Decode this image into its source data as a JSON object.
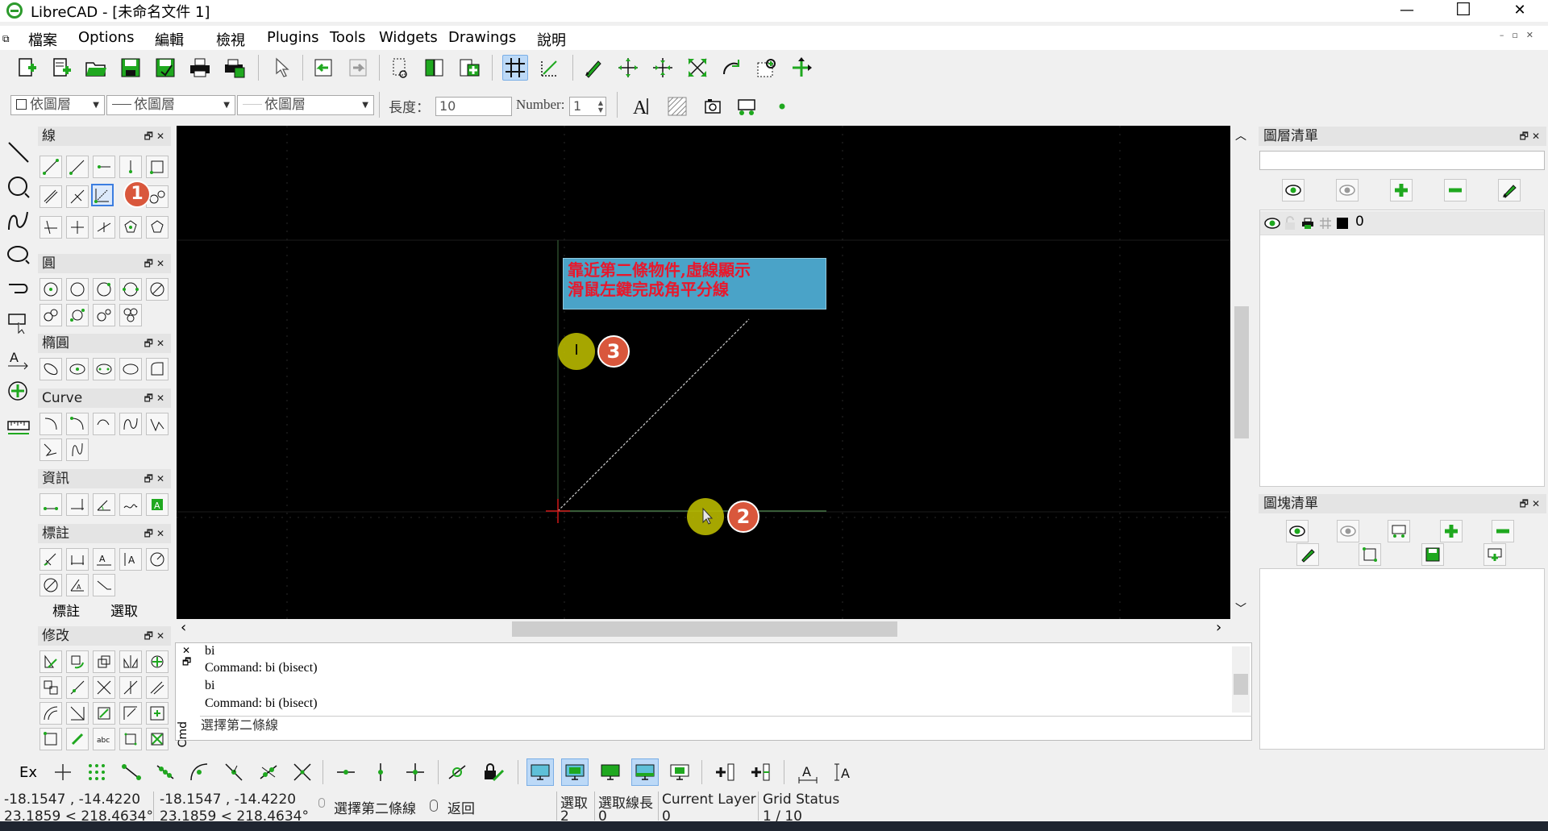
{
  "window": {
    "title": "LibreCAD - [未命名文件 1]",
    "minimize": "—",
    "maximize": "☐",
    "close": "✕"
  },
  "menu": [
    "檔案",
    "Options",
    "編輯",
    "檢視",
    "Plugins",
    "Tools",
    "Widgets",
    "Drawings",
    "說明"
  ],
  "pen_toolbar": {
    "color": "依圖層",
    "linetype": "依圖層",
    "width": "依圖層",
    "length_label": "長度：",
    "length_value": "10",
    "number_label": "Number:",
    "number_value": "1"
  },
  "docks": {
    "line": {
      "title": "線"
    },
    "circle": {
      "title": "圓"
    },
    "ellipse": {
      "title": "橢圓"
    },
    "curve": {
      "title": "Curve"
    },
    "info": {
      "title": "資訊"
    },
    "dimension": {
      "title": "標註",
      "tabs": [
        "標註",
        "選取"
      ]
    },
    "modify": {
      "title": "修改"
    }
  },
  "canvas": {
    "annotation_line1": "靠近第二條物件,虛線顯示",
    "annotation_line2": "滑鼠左鍵完成角平分線",
    "step_badges": [
      "1",
      "2",
      "3"
    ]
  },
  "command": {
    "history": [
      "bi",
      "Command: bi (bisect)",
      "bi",
      "Command: bi (bisect)"
    ],
    "prompt": "選擇第二條線",
    "side_label": "Cmd"
  },
  "layers": {
    "title": "圖層清單",
    "layer_name": "0"
  },
  "blocks": {
    "title": "圖塊清單"
  },
  "snap_toolbar": {
    "ex_label": "Ex"
  },
  "status": {
    "abs_coord": "-18.1547 , -14.4220",
    "abs_polar": "23.1859 < 218.4634°",
    "rel_coord": "-18.1547 , -14.4220",
    "rel_polar": "23.1859 < 218.4634°",
    "prompt": "選擇第二條線",
    "back": "返回",
    "selected_label": "選取",
    "selected_value": "2",
    "sel_length_label": "選取線長",
    "sel_length_value": "0",
    "current_layer_label": "Current Layer",
    "current_layer_value": "0",
    "grid_label": "Grid Status",
    "grid_value": "1 / 10"
  },
  "colors": {
    "accent": "#2aa52a",
    "badge": "#d9573c",
    "cursor_marker": "#b8b800",
    "annotation_bg": "#4aa3c8",
    "annotation_text": "#e8182c"
  }
}
